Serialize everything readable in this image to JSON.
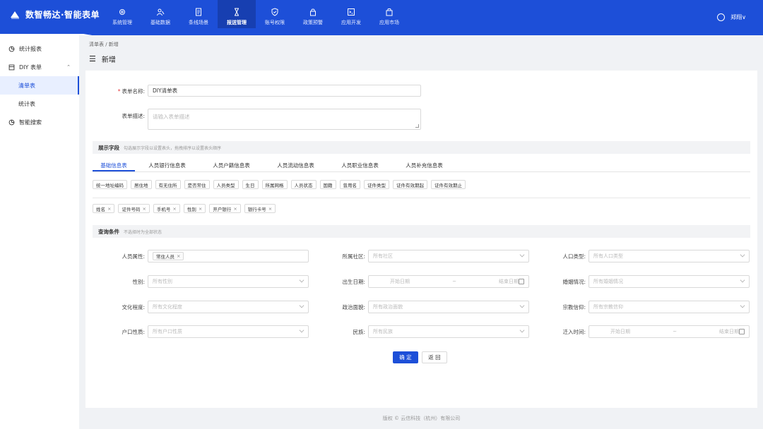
{
  "brand": {
    "title": "数智畅达·智能表单"
  },
  "nav": [
    {
      "label": "系统管理",
      "icon": "gear-icon"
    },
    {
      "label": "基础数据",
      "icon": "users-icon"
    },
    {
      "label": "条线场景",
      "icon": "document-icon"
    },
    {
      "label": "报送管理",
      "icon": "hourglass-icon",
      "active": true
    },
    {
      "label": "账号权限",
      "icon": "shield-icon"
    },
    {
      "label": "政策预警",
      "icon": "lock-icon"
    },
    {
      "label": "应用开发",
      "icon": "terminal-icon"
    },
    {
      "label": "应用市场",
      "icon": "bag-icon"
    }
  ],
  "user": {
    "name": "郑翔∨"
  },
  "sidebar": {
    "items": [
      {
        "label": "统计报表"
      },
      {
        "label": "DIY 表单",
        "chevron": "⌃"
      },
      {
        "label": "清单表",
        "active": true
      },
      {
        "label": "统计表"
      },
      {
        "label": "智能搜索"
      }
    ]
  },
  "breadcrumb": "清单表 / 新增",
  "page_title": "新增",
  "form": {
    "name_label": "表单名称:",
    "name_value": "DIY清单表",
    "desc_label": "表单描述:",
    "desc_placeholder": "请输入表单描述"
  },
  "display_section": {
    "title": "展示字段",
    "hint": "勾选展示字段以设置表头，拖拽排序以设置表头顺序"
  },
  "tabs": [
    "基础信息表",
    "人员银行信息表",
    "人员户籍信息表",
    "人员流动信息表",
    "人员职业信息表",
    "人员补充信息表"
  ],
  "field_chips": [
    "统一地址编码",
    "居住地",
    "有无住所",
    "是否常住",
    "人员类型",
    "生日",
    "所属网格",
    "人员状态",
    "国籍",
    "曾用名",
    "证件类型",
    "证件有效期起",
    "证件有效期止"
  ],
  "selected_chips": [
    "姓名",
    "证件号码",
    "手机号",
    "性别",
    "开户银行",
    "银行卡号"
  ],
  "query_section": {
    "title": "查询条件",
    "hint": "不选择时为全部状态"
  },
  "query": {
    "row1": [
      {
        "label": "人员属性:",
        "tag": "常住人员"
      },
      {
        "label": "所属社区:",
        "placeholder": "所有社区"
      },
      {
        "label": "人口类型:",
        "placeholder": "所有人口类型"
      }
    ],
    "row2": [
      {
        "label": "性别:",
        "placeholder": "所有性别"
      },
      {
        "label": "出生日期:",
        "start": "开始日期",
        "sep": "~",
        "end": "结束日期"
      },
      {
        "label": "婚姻情况:",
        "placeholder": "所有婚姻情况"
      }
    ],
    "row3": [
      {
        "label": "文化程度:",
        "placeholder": "所有文化程度"
      },
      {
        "label": "政治面貌:",
        "placeholder": "所有政治面貌"
      },
      {
        "label": "宗教信仰:",
        "placeholder": "所有宗教信仰"
      }
    ],
    "row4": [
      {
        "label": "户口性质:",
        "placeholder": "所有户口性质"
      },
      {
        "label": "民族:",
        "placeholder": "所有民族"
      },
      {
        "label": "迁入时间:",
        "start": "开始日期",
        "sep": "~",
        "end": "结束日期"
      }
    ]
  },
  "buttons": {
    "confirm": "确 定",
    "back": "返 回"
  },
  "footer": "版权 © 云信科技（杭州）有限公司",
  "colors": {
    "primary": "#1d4fd8",
    "required": "#e5383b"
  }
}
